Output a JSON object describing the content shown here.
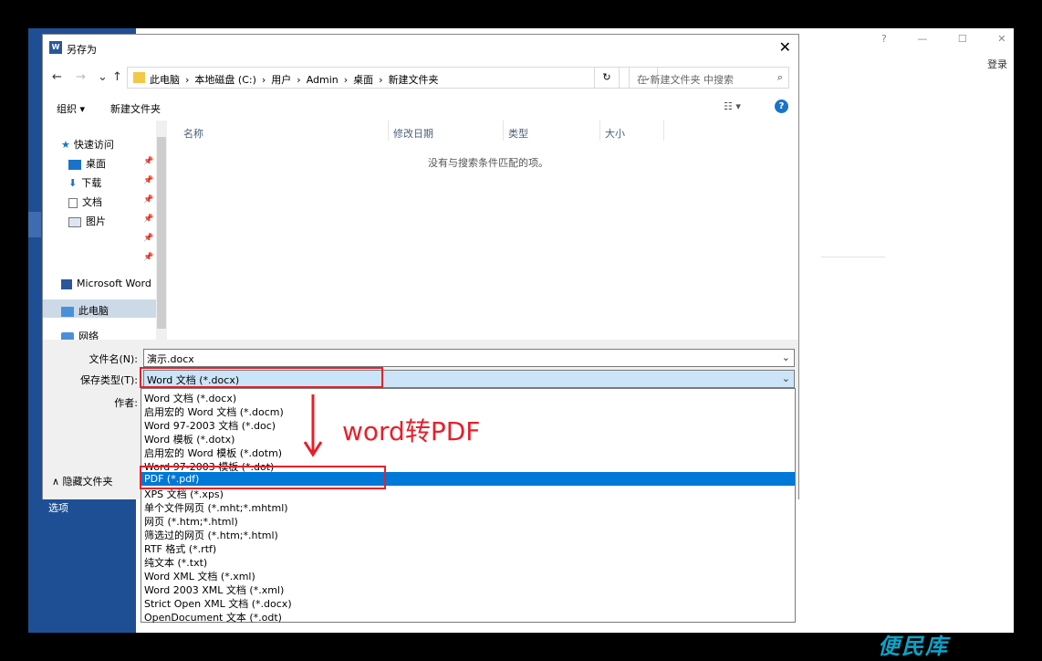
{
  "window": {
    "title": "另存为",
    "close": "✕"
  },
  "word_bg": {
    "option_label": "选项",
    "controls": [
      "?",
      "—",
      "☐",
      "✕"
    ],
    "login": "登录",
    "brand": "便民库"
  },
  "nav": {
    "back": "←",
    "forward": "→",
    "up": "↑",
    "crumbs": [
      "此电脑",
      "›",
      "本地磁盘 (C:)",
      "›",
      "用户",
      "›",
      "Admin",
      "›",
      "桌面",
      "›",
      "新建文件夹"
    ],
    "refresh": "↻",
    "search_placeholder": "在 新建文件夹 中搜索",
    "search_icon": "⌕"
  },
  "toolbar": {
    "organize": "组织 ▾",
    "new_folder": "新建文件夹",
    "view": "☷ ▾",
    "help": "?"
  },
  "nav_pane": {
    "quick_access": "快速访问",
    "items": [
      "桌面",
      "下载",
      "文档",
      "图片"
    ],
    "pin": "📌",
    "word": "Microsoft Word",
    "this_pc": "此电脑",
    "network": "网络"
  },
  "list": {
    "headers": [
      "名称",
      "修改日期",
      "类型",
      "大小"
    ],
    "empty": "没有与搜索条件匹配的项。"
  },
  "form": {
    "filename_label": "文件名(N):",
    "filename_value": "演示.docx",
    "filetype_label": "保存类型(T):",
    "filetype_value": "Word 文档 (*.docx)",
    "author_label": "作者:",
    "hide_folders": "∧  隐藏文件夹"
  },
  "filetypes": [
    "Word 文档 (*.docx)",
    "启用宏的 Word 文档 (*.docm)",
    "Word 97-2003 文档 (*.doc)",
    "Word 模板 (*.dotx)",
    "启用宏的 Word 模板 (*.dotm)",
    "Word 97-2003 模板 (*.dot)",
    "PDF (*.pdf)",
    "XPS 文档 (*.xps)",
    "单个文件网页 (*.mht;*.mhtml)",
    "网页 (*.htm;*.html)",
    "筛选过的网页 (*.htm;*.html)",
    "RTF 格式 (*.rtf)",
    "纯文本 (*.txt)",
    "Word XML 文档 (*.xml)",
    "Word 2003 XML 文档 (*.xml)",
    "Strict Open XML 文档 (*.docx)",
    "OpenDocument 文本 (*.odt)"
  ],
  "selected_filetype": 6,
  "annotation": {
    "text": "word转PDF",
    "color": "#e6202a"
  },
  "colors": {
    "accent": "#0078d7",
    "word_blue": "#1e4f94",
    "highlight": "#e6202a"
  }
}
